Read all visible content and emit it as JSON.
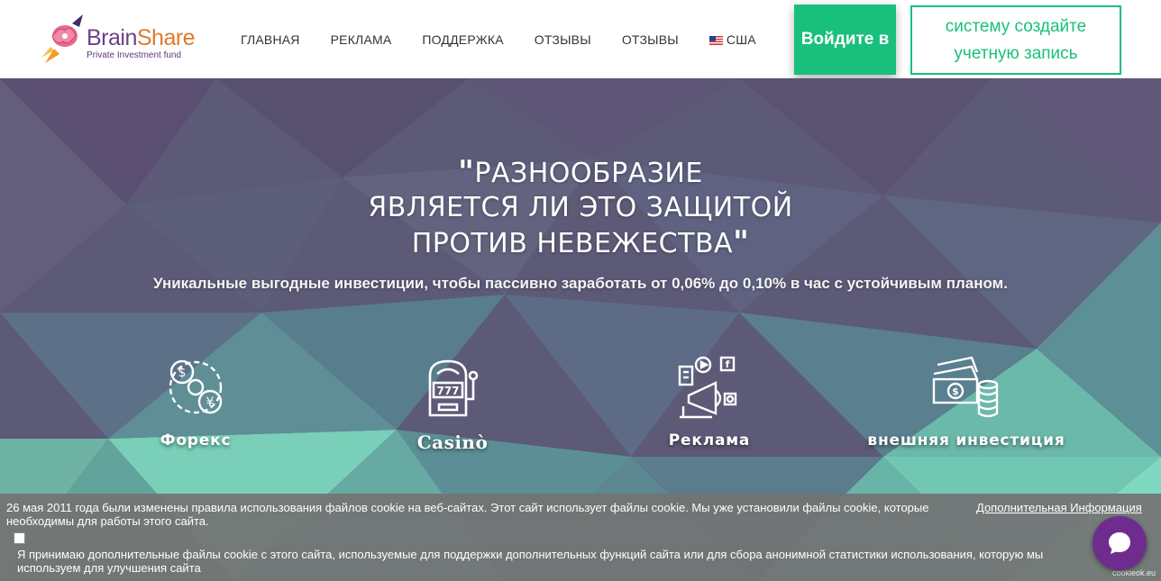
{
  "brand": {
    "name_part1": "Brain",
    "name_part2": "Share",
    "tagline": "Private Investment fund"
  },
  "nav": {
    "items": [
      {
        "label": "ГЛАВНАЯ"
      },
      {
        "label": "РЕКЛАМА"
      },
      {
        "label": "ПОДДЕРЖКА"
      },
      {
        "label": "ОТЗЫВЫ"
      },
      {
        "label": "ОТЗЫВЫ"
      }
    ],
    "locale": "США"
  },
  "header": {
    "login_label": "Войдите в",
    "register_label": "систему создайте учетную запись"
  },
  "hero": {
    "title_line1": "РАЗНООБРАЗИЕ",
    "title_line2": "ЯВЛЯЕТСЯ ЛИ ЭТО ЗАЩИТОЙ",
    "title_line3": "ПРОТИВ НЕВЕЖЕСТВА",
    "subtitle": "Уникальные выгодные инвестиции, чтобы пассивно заработать от 0,06% до 0,10% в час с устойчивым планом."
  },
  "features": [
    {
      "label": "Форекс",
      "icon": "forex-coins-icon"
    },
    {
      "label": "Casinò",
      "icon": "slot-machine-icon"
    },
    {
      "label": "Реклама",
      "icon": "advertising-megaphone-icon"
    },
    {
      "label": "внешняя инвестиция",
      "icon": "money-stack-icon"
    }
  ],
  "cookie": {
    "text": "26 мая 2011 года были изменены правила использования файлов cookie на веб-сайтах. Этот сайт использует файлы cookie. Мы уже установили файлы cookie, которые необходимы для работы этого сайта.",
    "more_link": "Дополнительная Информация",
    "accept_text": "Я принимаю дополнительные файлы cookie с этого сайта, используемые для поддержки дополнительных функций сайта или для сбора анонимной статистики использования, которую мы используем для улучшения сайта",
    "brand": "cookieok.eu"
  },
  "colors": {
    "accent": "#19c07b",
    "chat": "#6f2c8f"
  }
}
